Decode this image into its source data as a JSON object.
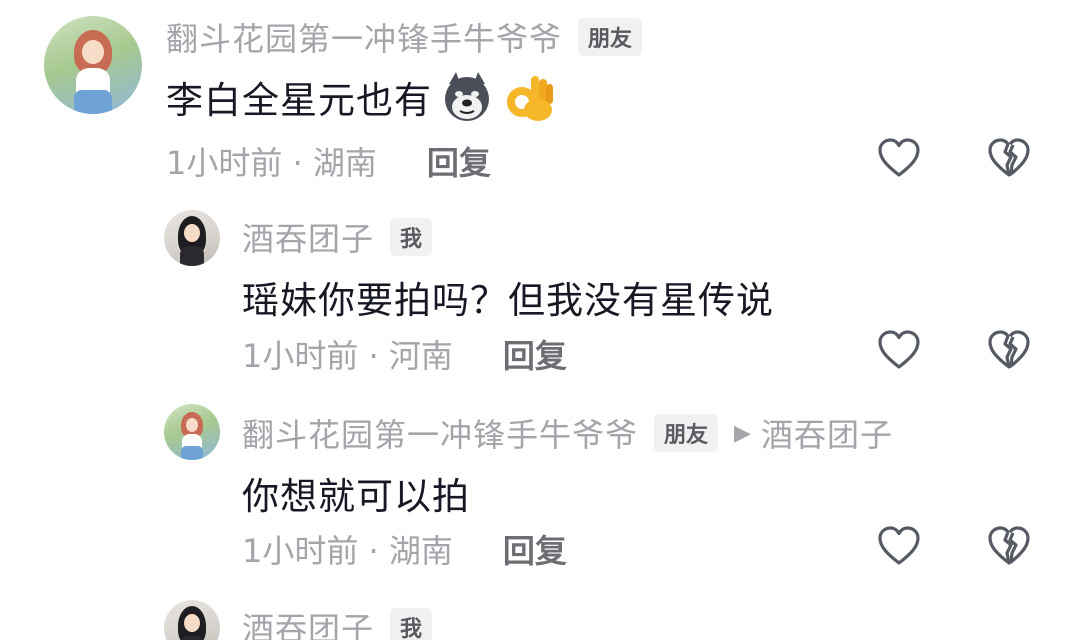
{
  "comments": [
    {
      "author": "翻斗花园第一冲锋手牛爷爷",
      "badge": "朋友",
      "text": "李白全星元也有",
      "emojis": [
        "husky-dog-emoji",
        "ok-hand-emoji"
      ],
      "time_location": "1小时前 · 湖南",
      "reply_label": "回复"
    },
    {
      "author": "酒吞团子",
      "badge": "我",
      "text": "瑶妹你要拍吗？但我没有星传说",
      "time_location": "1小时前 · 河南",
      "reply_label": "回复"
    },
    {
      "author": "翻斗花园第一冲锋手牛爷爷",
      "badge": "朋友",
      "reply_to": "酒吞团子",
      "text": "你想就可以拍",
      "time_location": "1小时前 · 湖南",
      "reply_label": "回复"
    },
    {
      "author": "酒吞团子",
      "badge": "我"
    }
  ],
  "icons": {
    "like": "heart-outline-icon",
    "dislike": "broken-heart-outline-icon",
    "reply_arrow": "triangle-right-icon"
  },
  "colors": {
    "primary_text": "#161823",
    "secondary_text": "#a4a5aa",
    "badge_bg": "#f1f1f2"
  }
}
